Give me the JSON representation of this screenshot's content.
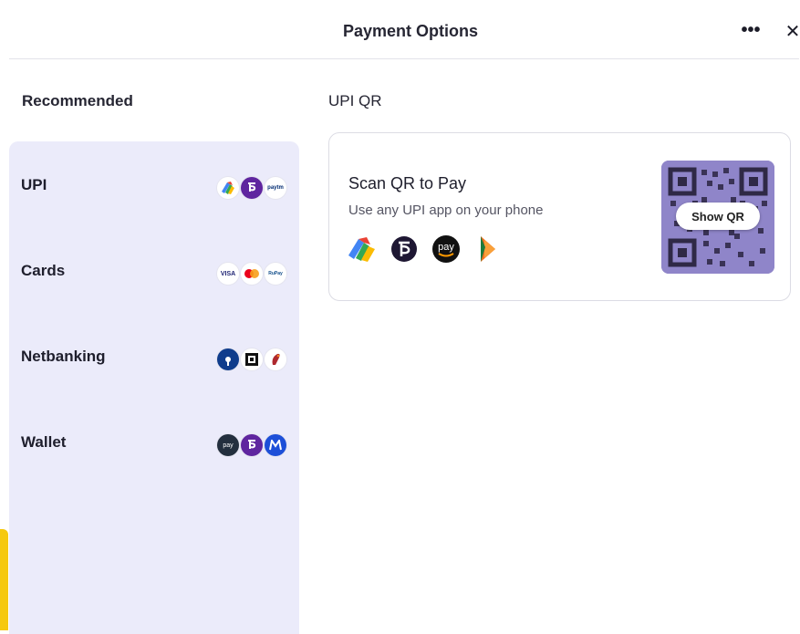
{
  "header": {
    "title": "Payment Options",
    "more_label": "•••",
    "close_label": "✕"
  },
  "sidebar": {
    "heading": "Recommended",
    "methods": [
      {
        "label": "UPI",
        "logos": [
          "google-pay-icon",
          "phonepe-icon",
          "paytm-icon"
        ]
      },
      {
        "label": "Cards",
        "logos": [
          "visa-icon",
          "mastercard-icon",
          "rupay-icon"
        ]
      },
      {
        "label": "Netbanking",
        "logos": [
          "sbi-icon",
          "hdfc-icon",
          "icici-icon"
        ]
      },
      {
        "label": "Wallet",
        "logos": [
          "amazon-pay-icon",
          "phonepe-icon",
          "mobikwik-icon"
        ]
      }
    ],
    "logo_text": {
      "paytm": "paytm",
      "visa": "VISA",
      "rupay": "RuPay",
      "amazon_pay": "pay"
    }
  },
  "main": {
    "heading": "UPI QR",
    "qr_card": {
      "title": "Scan QR to Pay",
      "subtitle": "Use any UPI app on your phone",
      "apps": [
        "google-pay-icon",
        "phonepe-icon",
        "amazon-pay-icon",
        "bhim-icon"
      ],
      "amazon_pay_text": "pay",
      "show_qr_label": "Show QR"
    }
  },
  "colors": {
    "sidebar_bg": "#ebebfa",
    "qr_tint": "#8f85c9",
    "accent_yellow": "#f6c90e",
    "phonepe_purple": "#5f259f"
  }
}
